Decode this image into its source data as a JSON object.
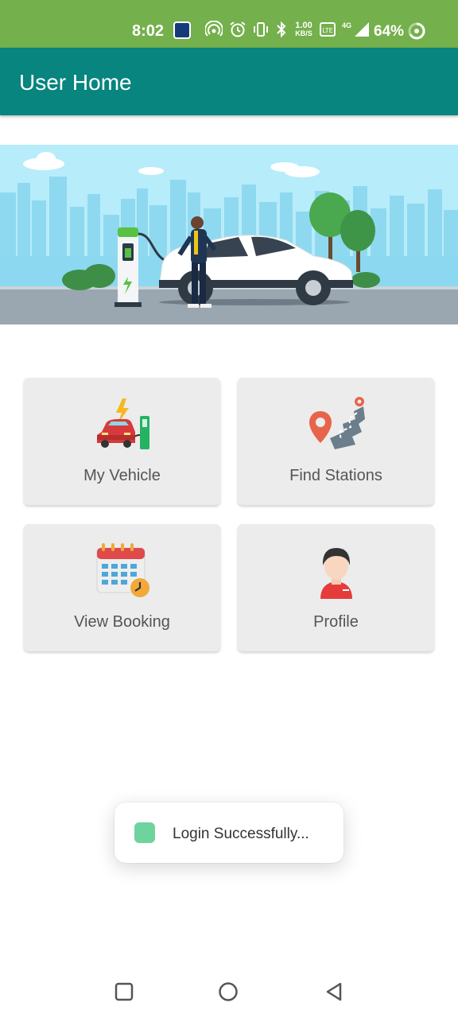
{
  "status_bar": {
    "time": "8:02",
    "speed_value": "1.00",
    "speed_unit": "KB/S",
    "network": "4G",
    "battery": "64%"
  },
  "app_bar": {
    "title": "User Home"
  },
  "menu": {
    "tiles": [
      {
        "label": "My Vehicle",
        "icon": "ev-car-charging-icon"
      },
      {
        "label": "Find Stations",
        "icon": "map-pin-route-icon"
      },
      {
        "label": "View Booking",
        "icon": "calendar-clock-icon"
      },
      {
        "label": "Profile",
        "icon": "person-avatar-icon"
      }
    ]
  },
  "toast": {
    "text": "Login Successfully..."
  },
  "colors": {
    "status_bar": "#74b04c",
    "app_bar": "#07857e",
    "tile_background": "#ececec"
  }
}
